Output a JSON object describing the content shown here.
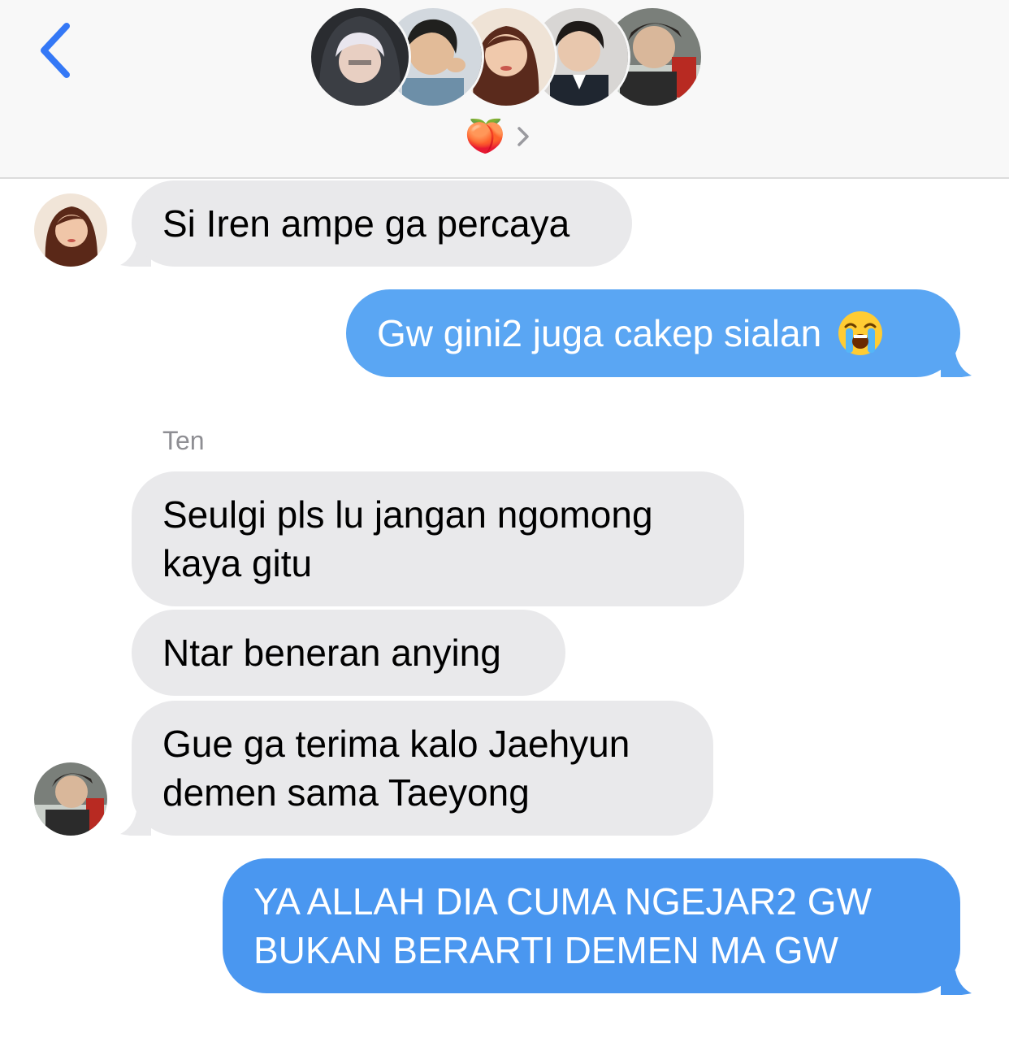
{
  "header": {
    "back_label": "Back",
    "group_emoji": "🍑",
    "members": [
      "member-1",
      "member-2",
      "member-3",
      "member-4",
      "member-5"
    ]
  },
  "messages": [
    {
      "side": "incoming",
      "text": "Si Iren ampe ga percaya"
    },
    {
      "side": "outgoing",
      "text": "Gw gini2 juga cakep sialan",
      "emoji": "loudly-crying-face"
    },
    {
      "side": "incoming",
      "sender": "Ten",
      "lines": [
        "Seulgi pls lu jangan ngomong",
        "kaya gitu"
      ]
    },
    {
      "side": "incoming",
      "text": "Ntar beneran anying"
    },
    {
      "side": "incoming",
      "lines": [
        "Gue ga terima kalo Jaehyun",
        "demen sama Taeyong"
      ]
    },
    {
      "side": "outgoing",
      "lines": [
        "YA ALLAH DIA CUMA NGEJAR2 GW",
        "BUKAN BERARTI DEMEN MA GW"
      ]
    }
  ],
  "colors": {
    "incoming_bubble": "#e9e9eb",
    "outgoing_bubble": "#5aa6f3",
    "accent": "#3478f6",
    "sender_label": "#8e8e93"
  }
}
